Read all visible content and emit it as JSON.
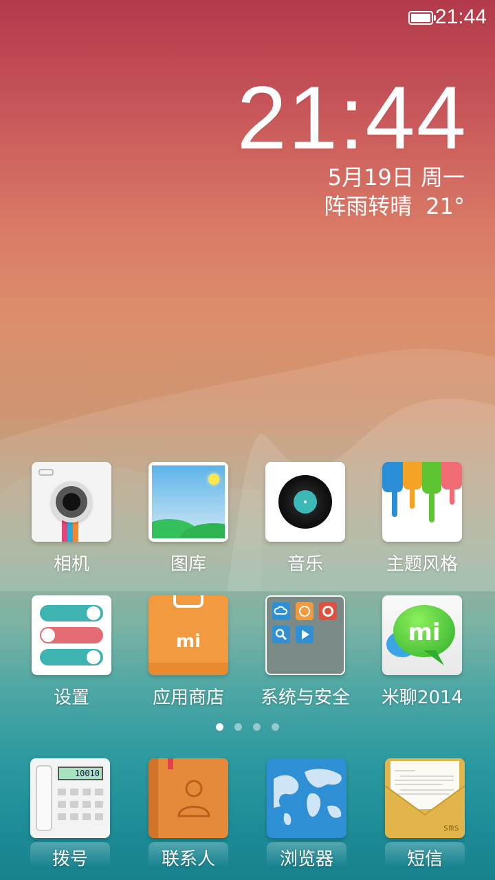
{
  "status_bar": {
    "time": "21:44",
    "battery_icon": "battery-full-icon"
  },
  "clock_widget": {
    "time": "21:44",
    "date": "5月19日 周一",
    "weather": "阵雨转晴",
    "temperature": "21°"
  },
  "apps": [
    {
      "label": "相机",
      "icon": "camera-icon"
    },
    {
      "label": "图库",
      "icon": "gallery-icon"
    },
    {
      "label": "音乐",
      "icon": "music-icon"
    },
    {
      "label": "主题风格",
      "icon": "themes-icon"
    },
    {
      "label": "设置",
      "icon": "settings-icon"
    },
    {
      "label": "应用商店",
      "icon": "app-store-icon"
    },
    {
      "label": "系统与安全",
      "icon": "folder-icon"
    },
    {
      "label": "米聊2014",
      "icon": "miliao-icon"
    }
  ],
  "app_store_logo": "mi",
  "miliao_logo": "mi",
  "folder_tiles": [
    "cloud-icon",
    "mi-circle-icon",
    "mi-red-icon",
    "search-icon",
    "play-icon"
  ],
  "page_indicator": {
    "pages": 4,
    "active": 0
  },
  "dock": [
    {
      "label": "拨号",
      "icon": "phone-icon",
      "display": "10010"
    },
    {
      "label": "联系人",
      "icon": "contacts-icon"
    },
    {
      "label": "浏览器",
      "icon": "browser-icon"
    },
    {
      "label": "短信",
      "icon": "sms-icon",
      "badge_text": "sms"
    }
  ]
}
